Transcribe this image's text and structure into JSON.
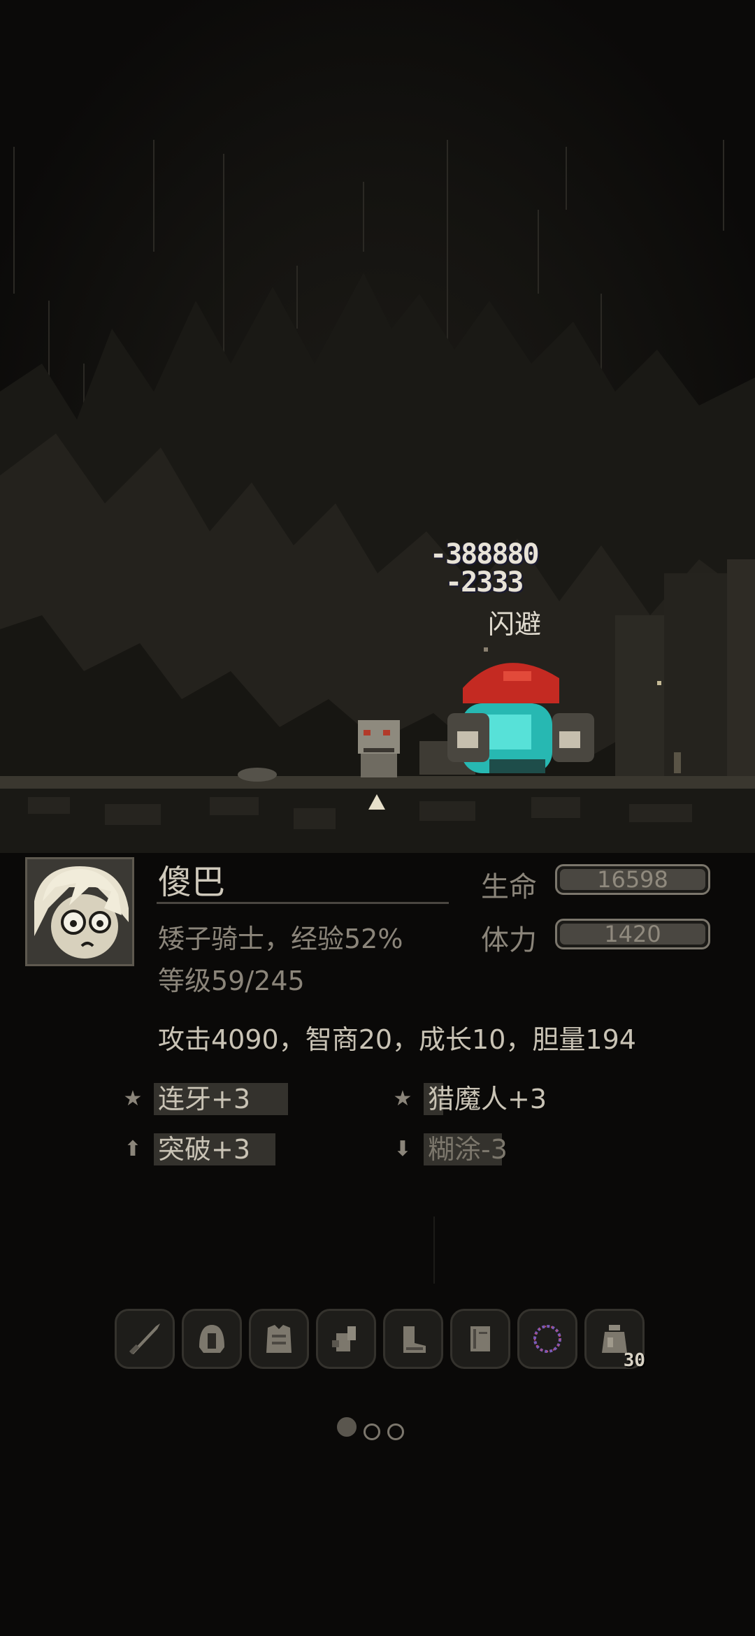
{
  "scene": {
    "damage_numbers": [
      "-388880",
      "-2333"
    ],
    "dodge_text": "闪避"
  },
  "character": {
    "name": "傻巴",
    "class_line": "矮子骑士，经验52%",
    "level_line": "等级59/245",
    "hp_label": "生命",
    "hp_value": "16598",
    "stamina_label": "体力",
    "stamina_value": "1420",
    "attributes_line": "攻击4090，智商20，成长10，胆量194"
  },
  "traits": [
    {
      "icon": "star-icon",
      "text": "连牙+3"
    },
    {
      "icon": "star-icon",
      "text": "猎魔人+3"
    },
    {
      "icon": "arrow-up-icon",
      "text": "突破+3"
    },
    {
      "icon": "arrow-down-icon",
      "text": "糊涂-3"
    }
  ],
  "equipment": [
    {
      "icon": "sword-icon"
    },
    {
      "icon": "helmet-icon"
    },
    {
      "icon": "armor-icon"
    },
    {
      "icon": "gauntlet-icon"
    },
    {
      "icon": "boots-icon"
    },
    {
      "icon": "book-icon"
    },
    {
      "icon": "necklace-icon"
    },
    {
      "icon": "potion-jar-icon",
      "count": "30"
    }
  ],
  "pager": {
    "pages": 3,
    "active": 0
  }
}
